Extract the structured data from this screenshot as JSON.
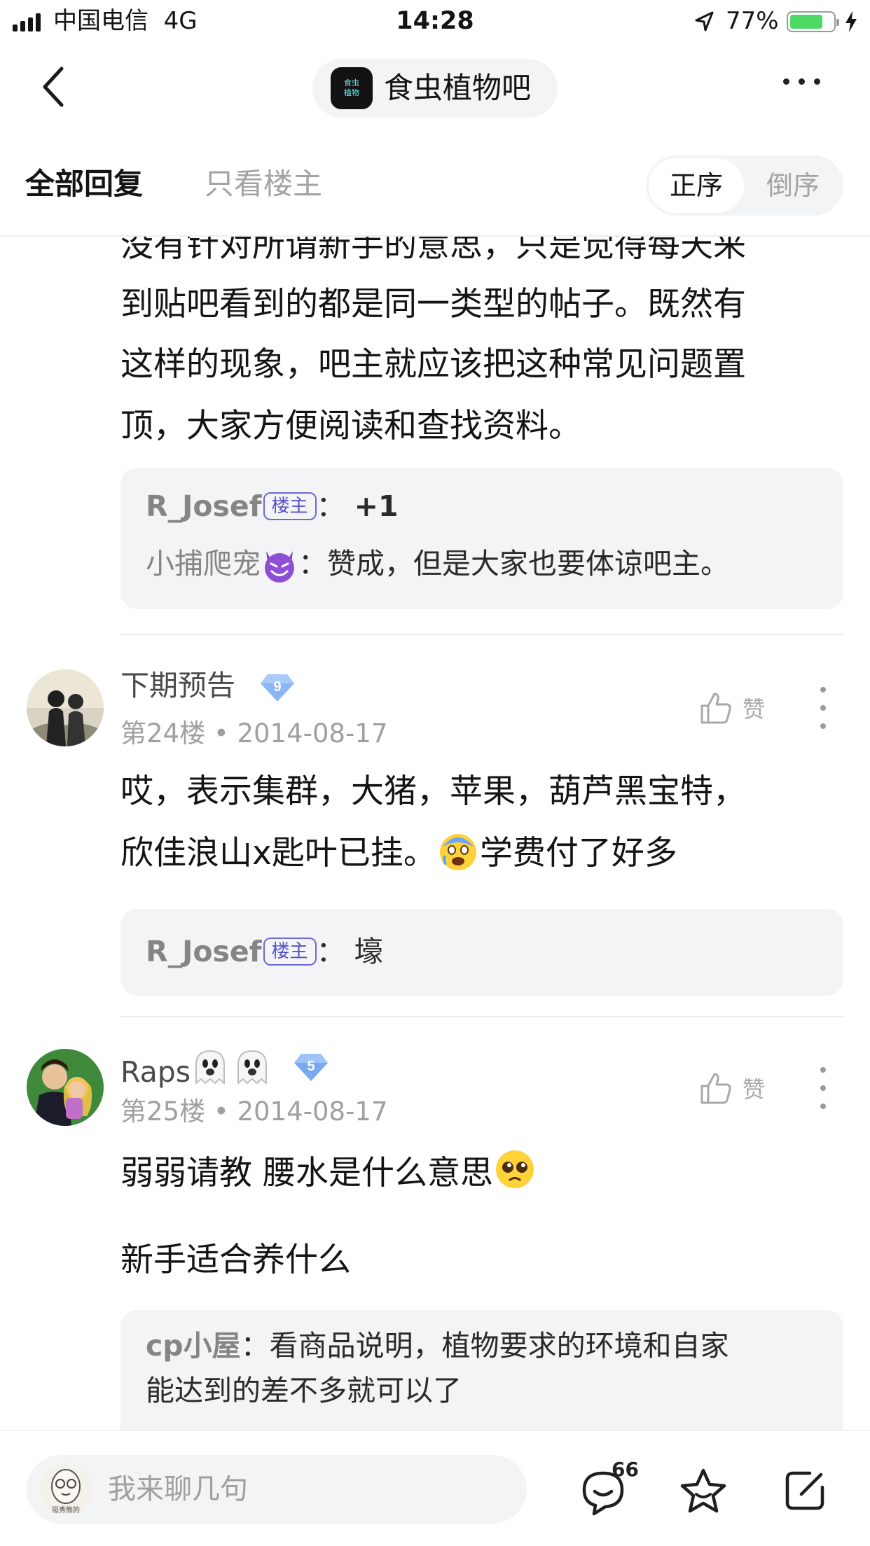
{
  "status_bar": {
    "carrier": "中国电信",
    "network": "4G",
    "time": "14:28",
    "battery_percent": "77%",
    "battery_level": 0.77,
    "battery_color": "#4cd964"
  },
  "nav": {
    "back_icon": "chevron-left-icon",
    "forum_logo_text_1": "食虫",
    "forum_logo_text_2": "植物",
    "forum_name": "食虫植物吧",
    "more_icon": "ellipsis-icon"
  },
  "filter": {
    "tab_all": "全部回复",
    "tab_op_only": "只看楼主",
    "order_asc": "正序",
    "order_desc": "倒序"
  },
  "prev_post": {
    "lines": [
      "没有针对所谓新手的意思，只是觉得每天来",
      "到贴吧看到的都是同一类型的帖子。既然有",
      "这样的现象，吧主就应该把这种常见问题置",
      "顶，大家方便阅读和查找资料。"
    ],
    "replies": [
      {
        "user": "R_Josef",
        "badge": "楼主",
        "sep": "：",
        "text": "+1"
      },
      {
        "user": "小捕爬宠",
        "emoji": "smiling-devil",
        "sep": "：",
        "text": "赞成，但是大家也要体谅吧主。"
      }
    ]
  },
  "posts": [
    {
      "username": "下期预告",
      "level": "9",
      "floor": "第24楼",
      "dot": "•",
      "date": "2014-08-17",
      "like_label": "赞",
      "content_line_1": "哎，表示集群，大猪，苹果，葫芦黑宝特，",
      "content_line_2a": "欣佳浪山x匙叶已挂。",
      "content_emoji": "crying-scared-face",
      "content_line_2b": "学费付了好多",
      "reply": {
        "user": "R_Josef",
        "badge": "楼主",
        "sep": "：",
        "text": "壕"
      }
    },
    {
      "username": "Raps",
      "username_emoji": "ghost",
      "level": "5",
      "floor": "第25楼",
      "dot": "•",
      "date": "2014-08-17",
      "like_label": "赞",
      "content_line_1": "弱弱请教 腰水是什么意思",
      "content_emoji": "pleading-face",
      "content_line_2": "新手适合养什么",
      "reply": {
        "user": "cp小屋",
        "sep": "：",
        "text_1": "看商品说明，植物要求的环境和自家",
        "text_2": "能达到的差不多就可以了"
      }
    }
  ],
  "bottom_bar": {
    "me_avatar_caption": "挺秀熊的",
    "placeholder": "我来聊几句",
    "comment_count": "66",
    "comments_icon": "comment-bubble-icon",
    "favorite_icon": "star-icon",
    "share_icon": "share-edit-icon"
  }
}
